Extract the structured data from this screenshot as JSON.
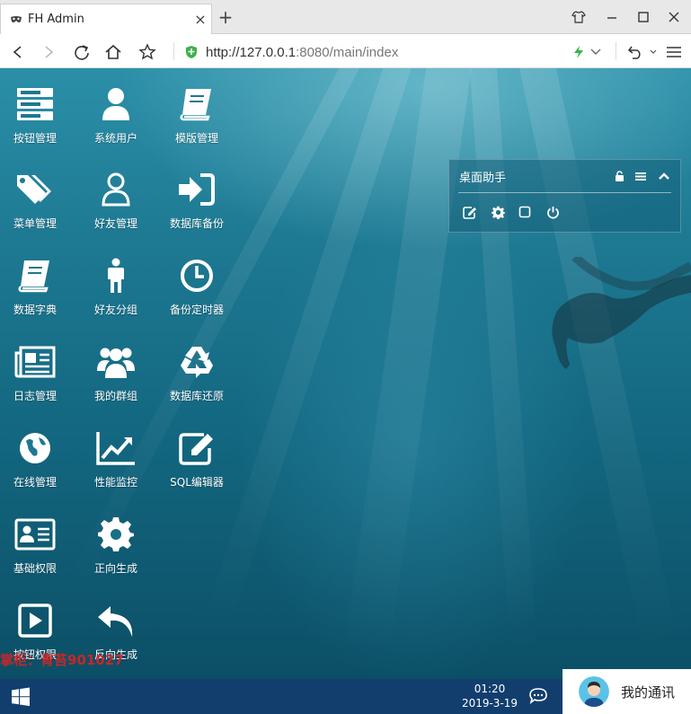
{
  "browser": {
    "tab_title": "FH Admin",
    "url_main": "http://127.0.0.1",
    "url_rest": ":8080/main/index"
  },
  "desktop_icons": [
    {
      "label": "按钮管理",
      "icon": "server-icon"
    },
    {
      "label": "系统用户",
      "icon": "user-icon"
    },
    {
      "label": "模版管理",
      "icon": "book-icon"
    },
    {
      "label": "菜单管理",
      "icon": "tags-icon"
    },
    {
      "label": "好友管理",
      "icon": "user-outline-icon"
    },
    {
      "label": "数据库备份",
      "icon": "sign-in-icon"
    },
    {
      "label": "数据字典",
      "icon": "book-icon"
    },
    {
      "label": "好友分组",
      "icon": "male-icon"
    },
    {
      "label": "备份定时器",
      "icon": "clock-icon"
    },
    {
      "label": "日志管理",
      "icon": "newspaper-icon"
    },
    {
      "label": "我的群组",
      "icon": "users-icon"
    },
    {
      "label": "数据库还原",
      "icon": "recycle-icon"
    },
    {
      "label": "在线管理",
      "icon": "globe-icon"
    },
    {
      "label": "性能监控",
      "icon": "line-chart-icon"
    },
    {
      "label": "SQL编辑器",
      "icon": "edit-icon"
    },
    {
      "label": "基础权限",
      "icon": "id-card-icon"
    },
    {
      "label": "正向生成",
      "icon": "gear-icon"
    },
    {
      "label": "按钮权限",
      "icon": "play-square-icon"
    },
    {
      "label": "反向生成",
      "icon": "reply-icon"
    }
  ],
  "assistant_panel": {
    "title": "桌面助手"
  },
  "watermark": "掌柜：青苔901027",
  "taskbar": {
    "time": "01:20",
    "date": "2019-3-19",
    "contacts_label": "我的通讯"
  }
}
